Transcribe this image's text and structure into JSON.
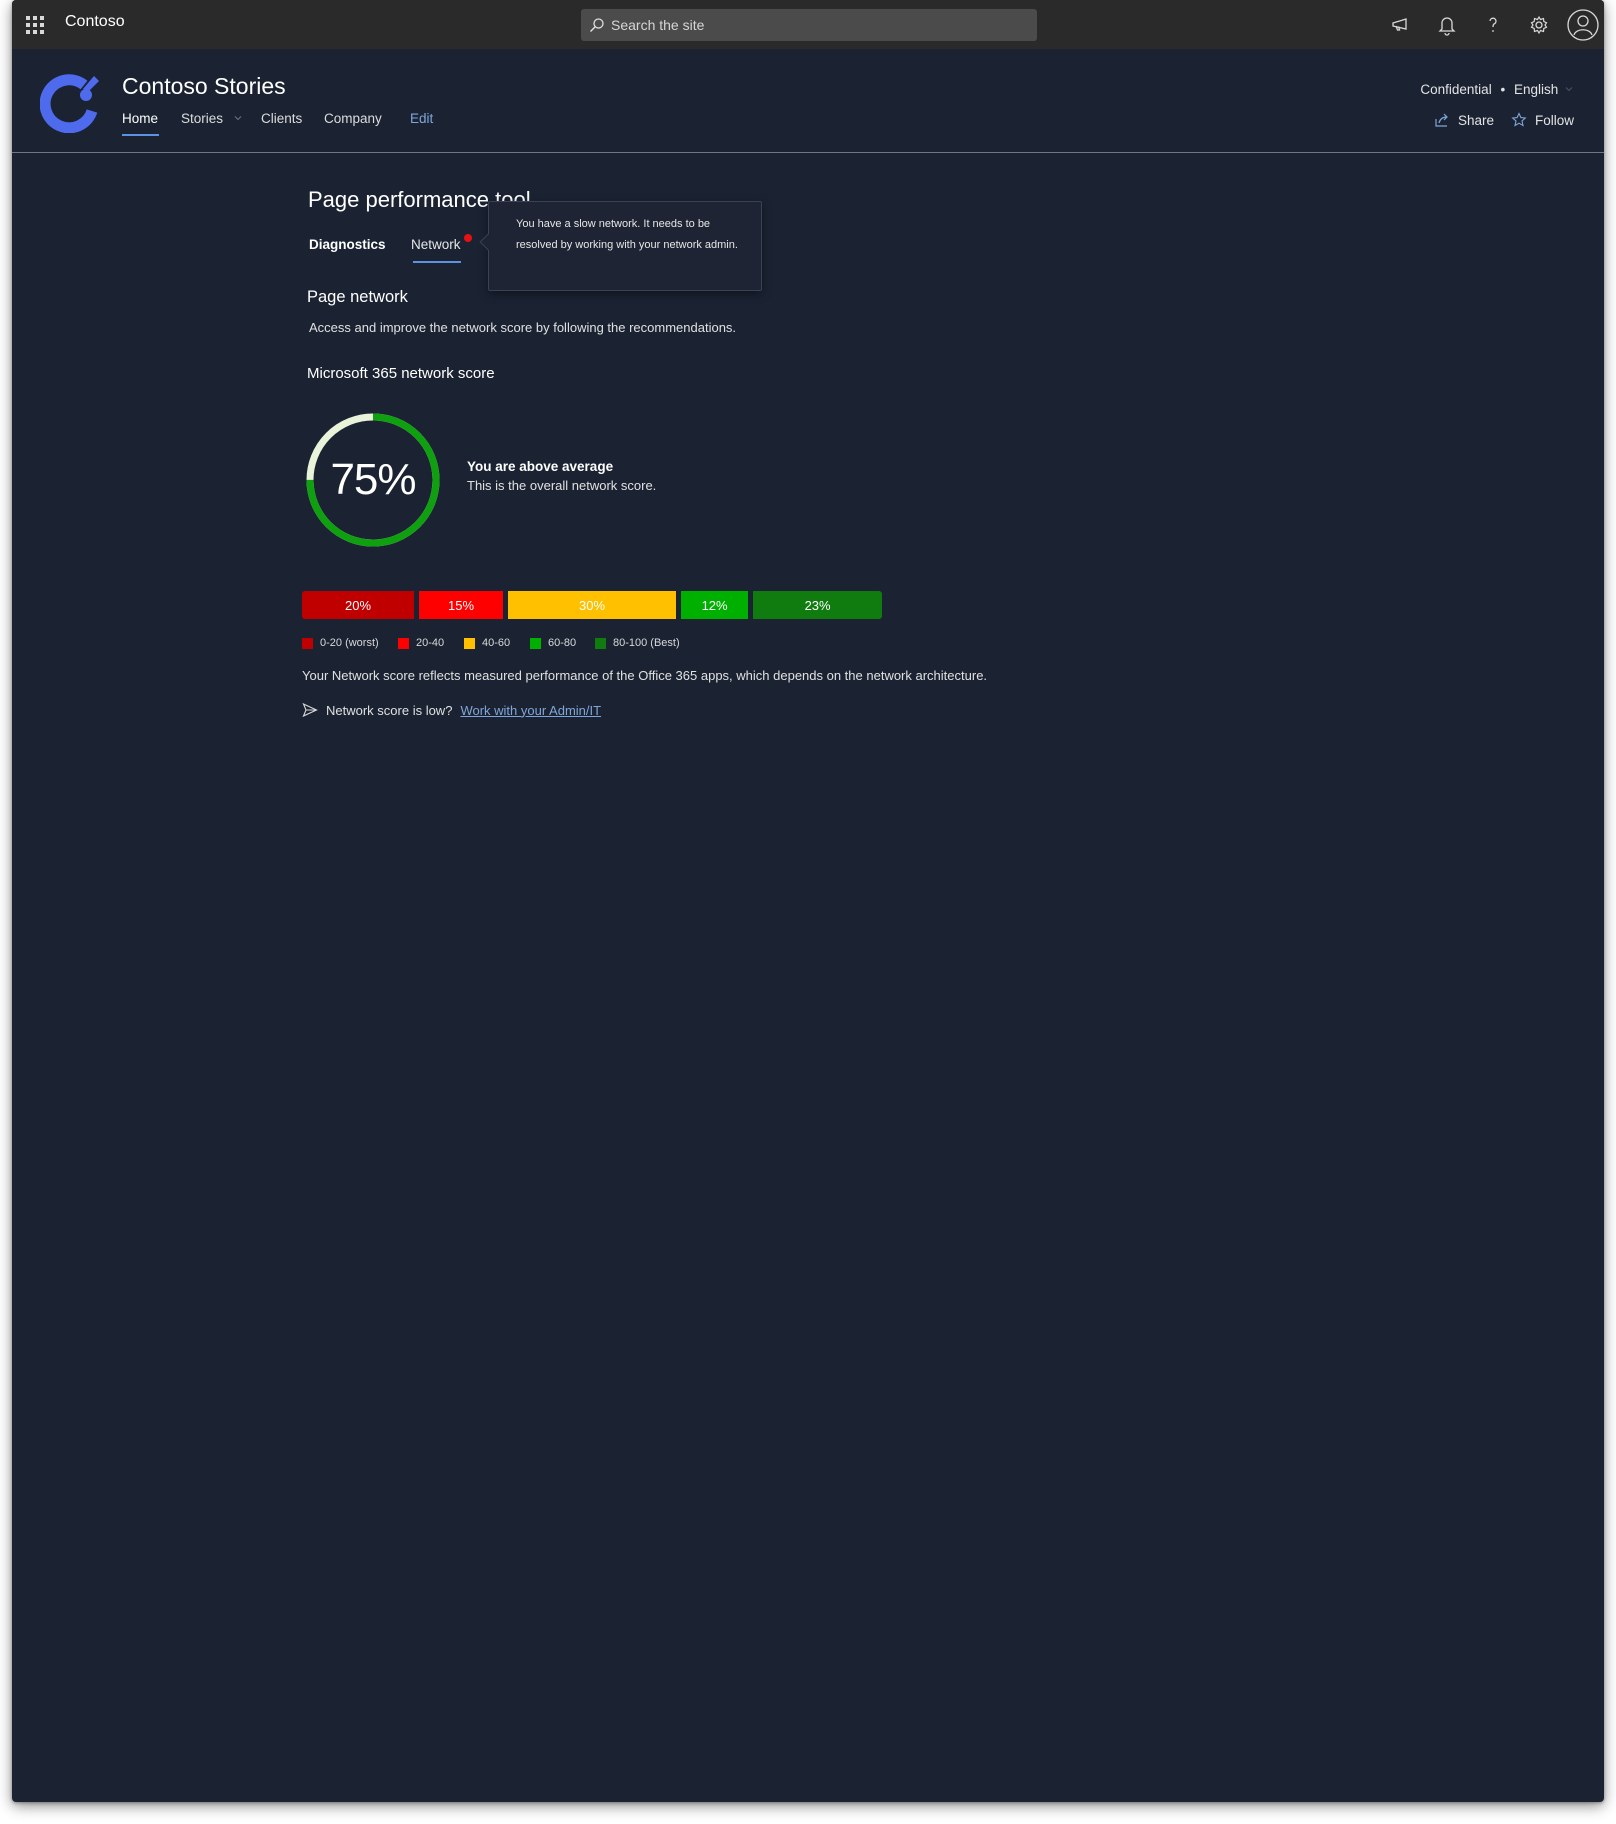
{
  "suite": {
    "app_name": "Contoso",
    "search_placeholder": "Search the site"
  },
  "site": {
    "title": "Contoso Stories",
    "nav": [
      {
        "label": "Home",
        "active": true
      },
      {
        "label": "Stories",
        "has_dropdown": true
      },
      {
        "label": "Clients"
      },
      {
        "label": "Company"
      },
      {
        "label": "Edit"
      }
    ],
    "classification": "Confidential",
    "separator": "•",
    "language": "English",
    "share_label": "Share",
    "follow_label": "Follow"
  },
  "tool": {
    "title": "Page performance tool",
    "tabs": [
      {
        "label": "Diagnostics"
      },
      {
        "label": "Network",
        "selected": true,
        "has_alert": true
      }
    ],
    "tooltip_text": "You have a slow network. It needs to be resolved by working with your network admin."
  },
  "network": {
    "section_title": "Page network",
    "description": "Access and improve the network score by following the recommendations.",
    "score_heading": "Microsoft 365 network score",
    "score_percent": 75,
    "score_label": "75%",
    "verdict": "You are above average",
    "caption": "This is the overall network score.",
    "distribution": [
      {
        "label": "20%",
        "value": 20,
        "range": "0-20 (worst)",
        "color": "#c00000"
      },
      {
        "label": "15%",
        "value": 15,
        "range": "20-40",
        "color": "#ff0000"
      },
      {
        "label": "30%",
        "value": 30,
        "range": "40-60",
        "color": "#ffc000"
      },
      {
        "label": "12%",
        "value": 12,
        "range": "60-80",
        "color": "#00b000"
      },
      {
        "label": "23%",
        "value": 23,
        "range": "80-100 (Best)",
        "color": "#107c10"
      }
    ],
    "reflect_text": "Your Network score reflects measured performance of the Office 365 apps, which depends on the network architecture.",
    "low_prompt": "Network score is low?",
    "admin_link": "Work with your Admin/IT"
  },
  "colors": {
    "page_bg": "#1b2333",
    "suitebar_bg": "#2a2a2a",
    "accent": "#5b93e0",
    "logo": "#4f6bed",
    "gauge_track": "#e8f3d9",
    "gauge_fill": "#0fa00f"
  },
  "icons": [
    "waffle-icon",
    "search-icon",
    "megaphone-icon",
    "bell-icon",
    "help-icon",
    "gear-icon",
    "account-icon",
    "share-icon",
    "star-icon",
    "send-icon",
    "chevron-down-icon"
  ]
}
